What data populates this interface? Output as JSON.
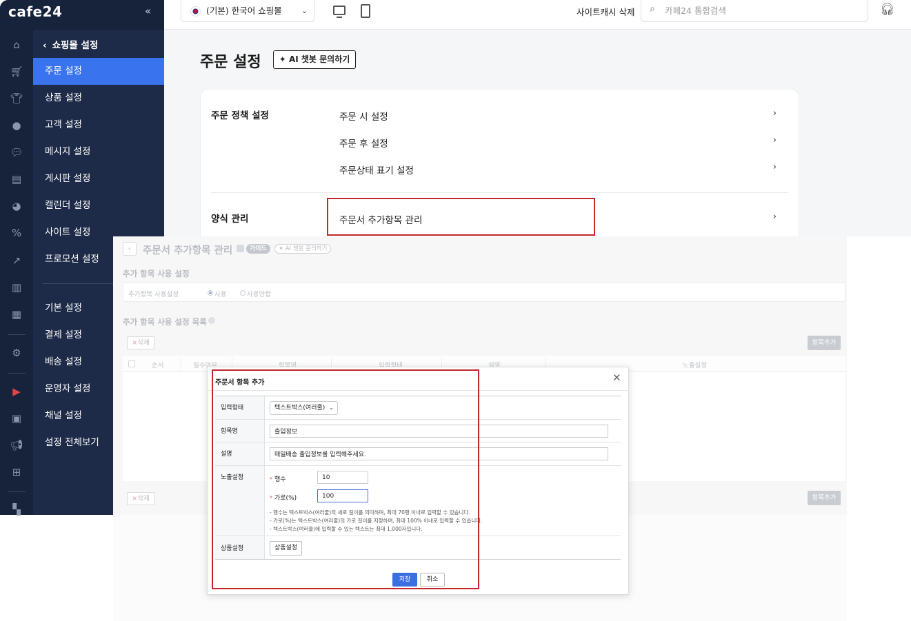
{
  "app": {
    "logo": "cafe24",
    "collapse_icon": "«"
  },
  "sidebar": {
    "back_label": "쇼핑몰 설정",
    "items": [
      {
        "label": "주문 설정",
        "active": true
      },
      {
        "label": "상품 설정"
      },
      {
        "label": "고객 설정"
      },
      {
        "label": "메시지 설정"
      },
      {
        "label": "게시판 설정"
      },
      {
        "label": "캘린더 설정"
      },
      {
        "label": "사이트 설정"
      },
      {
        "label": "프로모션 설정"
      },
      {
        "label": "기본 설정"
      },
      {
        "label": "결제 설정"
      },
      {
        "label": "배송 설정"
      },
      {
        "label": "운영자 설정"
      },
      {
        "label": "채널 설정"
      },
      {
        "label": "설정 전체보기"
      }
    ]
  },
  "topbar": {
    "mall_select": "(기본) 한국어 쇼핑몰",
    "cache_button": "사이트캐시 삭제",
    "search_placeholder": "카페24 통합검색"
  },
  "main": {
    "title": "주문 설정",
    "ai_button": "AI 챗봇 문의하기",
    "sections": [
      {
        "title": "주문 정책 설정",
        "items": [
          "주문 시 설정",
          "주문 후 설정",
          "주문상태 표기 설정"
        ]
      },
      {
        "title": "양식 관리",
        "items": [
          "주문서 추가항목 관리"
        ]
      }
    ]
  },
  "sub_page": {
    "title": "주문서 추가항목 관리",
    "guide_badge": "가이드",
    "ai_badge": "AI 챗봇 문의하기",
    "usage_section": "추가 항목 사용 설정",
    "usage_label": "추가항목 사용설정",
    "usage_options": [
      "사용",
      "사용안함"
    ],
    "list_section": "추가 항목 사용 설정 목록",
    "delete_button": "삭제",
    "add_button": "항목추가",
    "columns": [
      "순서",
      "필수여부",
      "항목명",
      "입력형태",
      "설명",
      "노출설정"
    ]
  },
  "modal": {
    "title": "주문서 항목 추가",
    "rows": {
      "input_type_label": "입력형태",
      "input_type_value": "텍스트박스(여러줄)",
      "item_name_label": "항목명",
      "item_name_value": "출입정보",
      "desc_label": "설명",
      "desc_value": "매일배송 출입정보를 입력해주세요.",
      "display_label": "노출설정",
      "rows_label": "행수",
      "rows_value": "10",
      "width_label": "가로(%)",
      "width_value": "100",
      "help": [
        "- 행수는 텍스트박스(여러줄)의 세로 길이를 의미하며, 최대 70행 이내로 입력할 수 있습니다.",
        "- 가로(%)는 텍스트박스(여러줄)의 가로 길이를 지정하며, 최대 100% 이내로 입력할 수 있습니다.",
        "- 텍스트박스(여러줄)에 입력할 수 있는 텍스트는 최대 1,000자입니다."
      ],
      "product_label": "상품설정",
      "product_button": "상품설정"
    },
    "save_button": "저장",
    "cancel_button": "취소"
  },
  "colors": {
    "accent": "#3a73ee",
    "sidebar": "#1e2b48",
    "highlight": "#c0272d"
  }
}
